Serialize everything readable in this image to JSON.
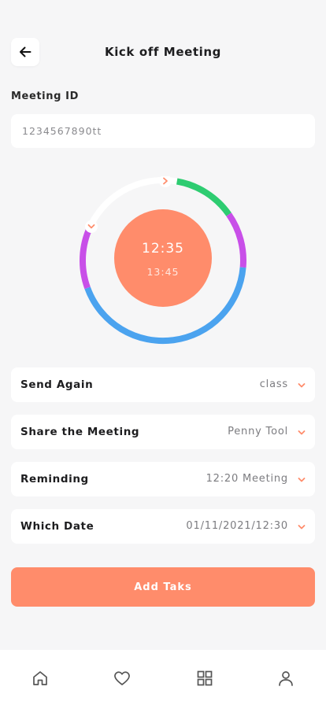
{
  "header": {
    "title": "Kick off Meeting",
    "back_icon": "arrow-left-icon"
  },
  "meeting": {
    "label": "Meeting ID",
    "value": "1234567890tt"
  },
  "timer": {
    "start_time": "12:35",
    "end_time": "13:45",
    "disc_color": "#ff8c6b",
    "segments": [
      {
        "color": "#2ecc71",
        "name": "green"
      },
      {
        "color": "#c84fe8",
        "name": "purple"
      },
      {
        "color": "#4ba3ef",
        "name": "blue"
      },
      {
        "color": "#c84fe8",
        "name": "purple"
      },
      {
        "color": "#ffffff",
        "name": "white"
      }
    ],
    "handle_icons": [
      "chevron-right-icon",
      "chevron-down-icon"
    ]
  },
  "options": [
    {
      "label": "Send Again",
      "value": "class"
    },
    {
      "label": "Share the Meeting",
      "value": "Penny Tool"
    },
    {
      "label": "Reminding",
      "value": "12:20 Meeting"
    },
    {
      "label": "Which Date",
      "value": "01/11/2021/12:30"
    }
  ],
  "actions": {
    "add_task_label": "Add Taks"
  },
  "bottom_nav": {
    "items": [
      "home-icon",
      "heart-icon",
      "grid-icon",
      "user-icon"
    ]
  },
  "colors": {
    "accent": "#ff8c6b",
    "background": "#f6f6f7",
    "card": "#ffffff"
  }
}
